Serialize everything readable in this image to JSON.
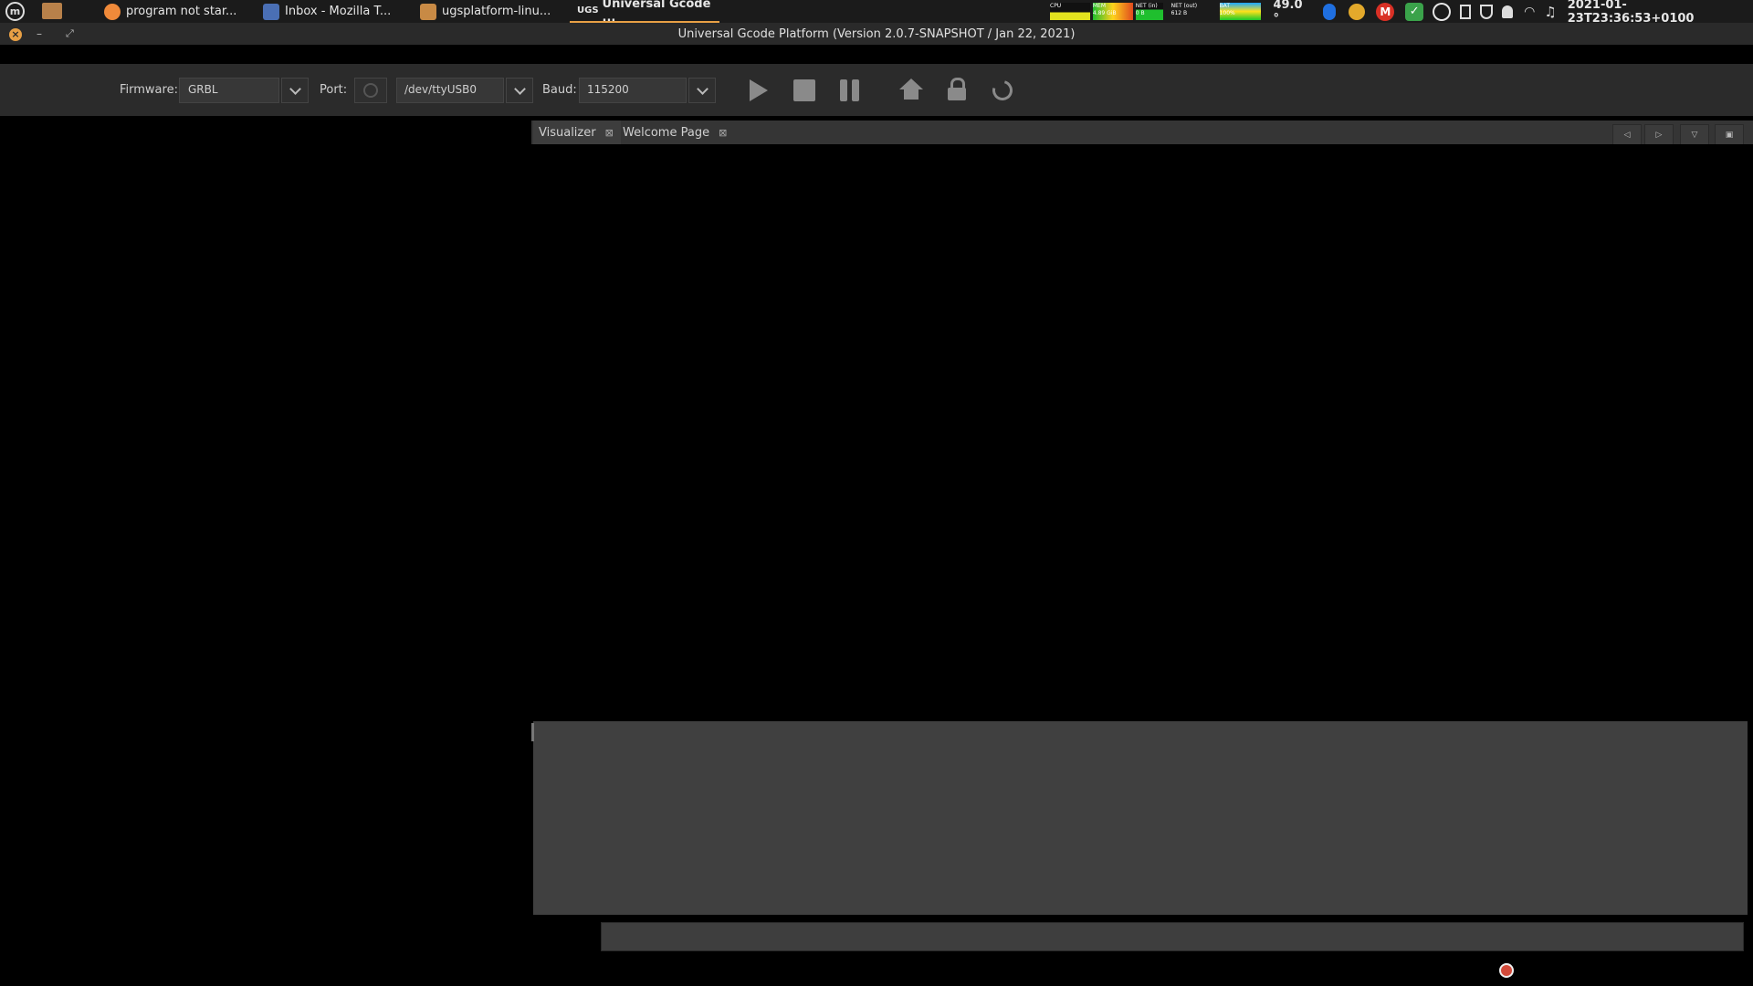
{
  "panel": {
    "tasks": [
      {
        "label": "program not star..."
      },
      {
        "label": "Inbox - Mozilla T..."
      },
      {
        "label": "ugsplatform-linu..."
      },
      {
        "label": "Universal Gcode ...",
        "prefix": "UGS"
      }
    ],
    "monitors": {
      "cpu": "CPU",
      "mem": "MEM",
      "mem_value": "4.89 GiB",
      "net_in": "NET (in)",
      "net_in_value": "0 B",
      "net_out": "NET (out)",
      "net_out_value": "612 B",
      "bat": "BAT",
      "bat_value": "100%"
    },
    "temperature": "49.0 °",
    "clock": "2021-01-23T23:36:53+0100"
  },
  "window": {
    "title": "Universal Gcode Platform (Version 2.0.7-SNAPSHOT / Jan 22, 2021)"
  },
  "toolbar": {
    "firmware_label": "Firmware:",
    "firmware_value": "GRBL",
    "port_label": "Port:",
    "port_value": "/dev/ttyUSB0",
    "baud_label": "Baud:",
    "baud_value": "115200"
  },
  "tabs": [
    {
      "label": "Visualizer"
    },
    {
      "label": "Welcome Page"
    }
  ],
  "colors": {
    "accent": "#e8a045",
    "panel": "#1b1b1b",
    "toolbar": "#2b2b2b",
    "console": "#404040"
  }
}
